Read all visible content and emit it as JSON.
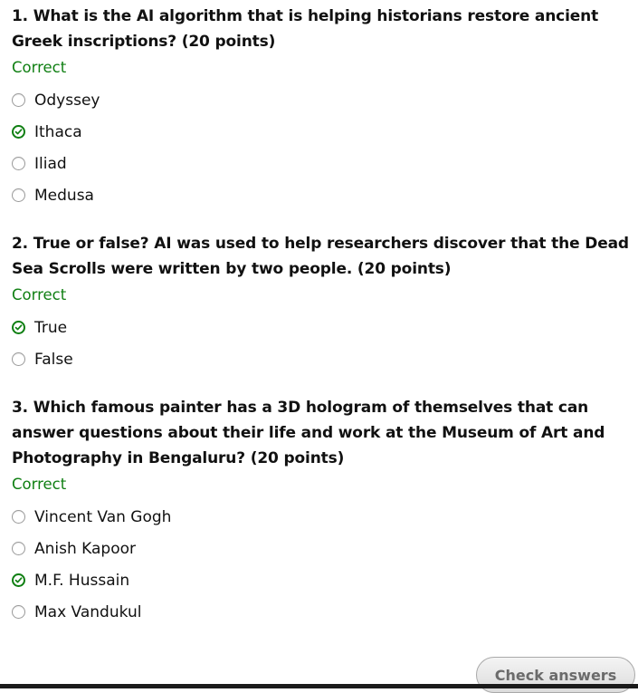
{
  "questions": [
    {
      "title": "1. What is the AI algorithm that is helping historians restore ancient Greek inscriptions? (20 points)",
      "status": "Correct",
      "options": [
        {
          "label": "Odyssey",
          "checked": false
        },
        {
          "label": "Ithaca",
          "checked": true
        },
        {
          "label": "Iliad",
          "checked": false
        },
        {
          "label": "Medusa",
          "checked": false
        }
      ]
    },
    {
      "title": "2. True or false? AI was used to help researchers discover that the Dead Sea Scrolls were written by two people. (20 points)",
      "status": "Correct",
      "options": [
        {
          "label": "True",
          "checked": true
        },
        {
          "label": "False",
          "checked": false
        }
      ]
    },
    {
      "title": "3. Which famous painter has a 3D hologram of themselves that can answer questions about their life and work at the Museum of Art and Photography in Bengaluru? (20 points)",
      "status": "Correct",
      "options": [
        {
          "label": "Vincent Van Gogh",
          "checked": false
        },
        {
          "label": "Anish Kapoor",
          "checked": false
        },
        {
          "label": "M.F. Hussain",
          "checked": true
        },
        {
          "label": "Max Vandukul",
          "checked": false
        }
      ]
    }
  ],
  "check_button": {
    "label": "Check answers"
  },
  "colors": {
    "correct": "#0f7f12",
    "text": "#111111",
    "radio_border": "#9a9a9a"
  },
  "icons": {
    "checked": "check-circle-icon",
    "unchecked": "radio-empty-icon"
  }
}
